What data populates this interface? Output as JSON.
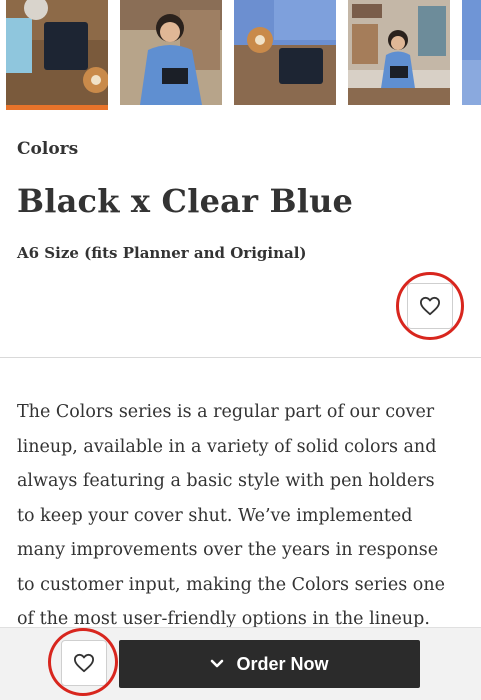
{
  "gallery": {
    "thumbnails": [
      {
        "alt": "cover-on-desk-with-donut",
        "active": true
      },
      {
        "alt": "person-eating-reading",
        "active": false
      },
      {
        "alt": "cover-with-pastry",
        "active": false
      },
      {
        "alt": "person-reading-bookshelf",
        "active": false
      },
      {
        "alt": "partial-next-thumbnail",
        "active": false
      }
    ],
    "active_color": "#e8732a"
  },
  "product": {
    "series": "Colors",
    "name": "Black x Clear Blue",
    "size": "A6 Size (fits Planner and Original)",
    "description": "The Colors series is a regular part of our cover lineup, available in a variety of solid colors and always featuring a basic style with pen holders to keep your cover shut. We’ve implemented many improvements over the years in response to customer input, making the Colors series one of the most user-friendly options in the lineup."
  },
  "actions": {
    "favorite_icon": "heart-outline-icon",
    "order_label": "Order Now",
    "order_icon": "chevron-down-icon"
  },
  "colors": {
    "highlight_ring": "#d8261e",
    "order_button_bg": "#2b2b2b",
    "bottom_bar_bg": "#f2f2f2"
  }
}
